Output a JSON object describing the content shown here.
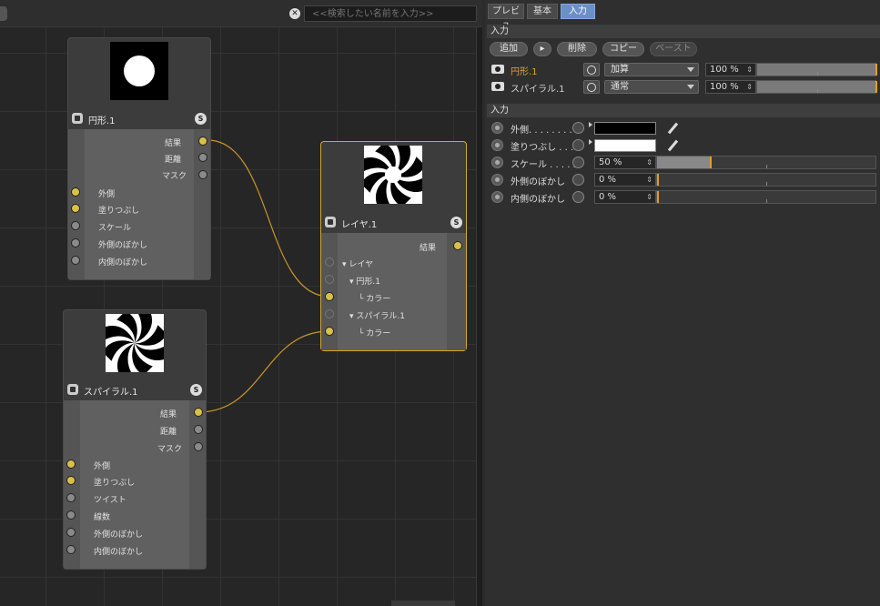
{
  "search": {
    "placeholder": "<<検索したい名前を入力>>"
  },
  "nodes": {
    "circle": {
      "title": "円形.1",
      "badge": "S",
      "outputs": [
        "結果",
        "距離",
        "マスク"
      ],
      "inputs": [
        "外側",
        "塗りつぶし",
        "スケール",
        "外側のぼかし",
        "内側のぼかし"
      ]
    },
    "spiral": {
      "title": "スパイラル.1",
      "badge": "S",
      "outputs": [
        "結果",
        "距離",
        "マスク"
      ],
      "inputs": [
        "外側",
        "塗りつぶし",
        "ツイスト",
        "線数",
        "外側のぼかし",
        "内側のぼかし"
      ]
    },
    "layer": {
      "title": "レイヤ.1",
      "badge": "S",
      "output": "結果",
      "tree": [
        "レイヤ",
        "円形.1",
        "カラー",
        "スパイラル.1",
        "カラー"
      ]
    }
  },
  "panel": {
    "tabs": [
      "プレビュ",
      "基本",
      "入力"
    ],
    "active_tab": "入力",
    "layers_section": "入力",
    "buttons": {
      "add": "追加",
      "delete": "削除",
      "copy": "コピー",
      "paste": "ペースト"
    },
    "layers": [
      {
        "name": "円形.1",
        "mode": "加算",
        "opacity": "100 %",
        "opacity_value": 1.0,
        "highlight": "#e8a030"
      },
      {
        "name": "スパイラル.1",
        "mode": "通常",
        "opacity": "100 %",
        "opacity_value": 1.0
      }
    ],
    "inputs_section": "入力",
    "inputs": {
      "outer": {
        "label": "外側. . . . . . . .",
        "color": "#000000"
      },
      "fill": {
        "label": "塗りつぶし . . .",
        "color": "#ffffff"
      },
      "scale": {
        "label": "スケール . . . . .",
        "value": "50 %",
        "value_num": 0.5
      },
      "outer_blur": {
        "label": "外側のぼかし",
        "value": "0 %",
        "value_num": 0
      },
      "inner_blur": {
        "label": "内側のぼかし",
        "value": "0 %",
        "value_num": 0
      }
    }
  },
  "colors": {
    "wire": "#c8962a",
    "port_active": "#d9c04a",
    "tab_active": "#6b8fc7",
    "selected_border": "#d8a52a"
  }
}
